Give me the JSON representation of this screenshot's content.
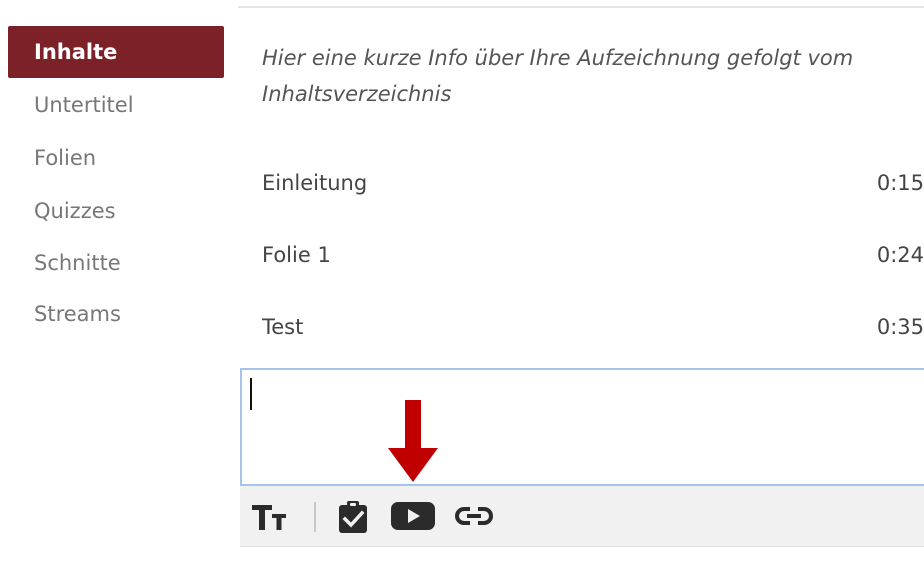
{
  "sidebar": {
    "items": [
      {
        "label": "Inhalte",
        "active": true
      },
      {
        "label": "Untertitel",
        "active": false
      },
      {
        "label": "Folien",
        "active": false
      },
      {
        "label": "Quizzes",
        "active": false
      },
      {
        "label": "Schnitte",
        "active": false
      },
      {
        "label": "Streams",
        "active": false
      }
    ]
  },
  "main": {
    "intro": "Hier eine kurze Info über Ihre Aufzeichnung gefolgt vom Inhaltsverzeichnis",
    "toc": [
      {
        "title": "Einleitung",
        "time": "0:15"
      },
      {
        "title": "Folie 1",
        "time": "0:24"
      },
      {
        "title": "Test",
        "time": "0:35"
      }
    ]
  },
  "editor": {
    "value": "",
    "toolbar": [
      {
        "icon": "text-size-icon"
      },
      {
        "icon": "quiz-clipboard-icon"
      },
      {
        "icon": "video-play-icon"
      },
      {
        "icon": "link-icon"
      }
    ]
  },
  "colors": {
    "accent": "#7d2128",
    "arrow": "#c00000",
    "editor_border": "#a4c4ec"
  }
}
